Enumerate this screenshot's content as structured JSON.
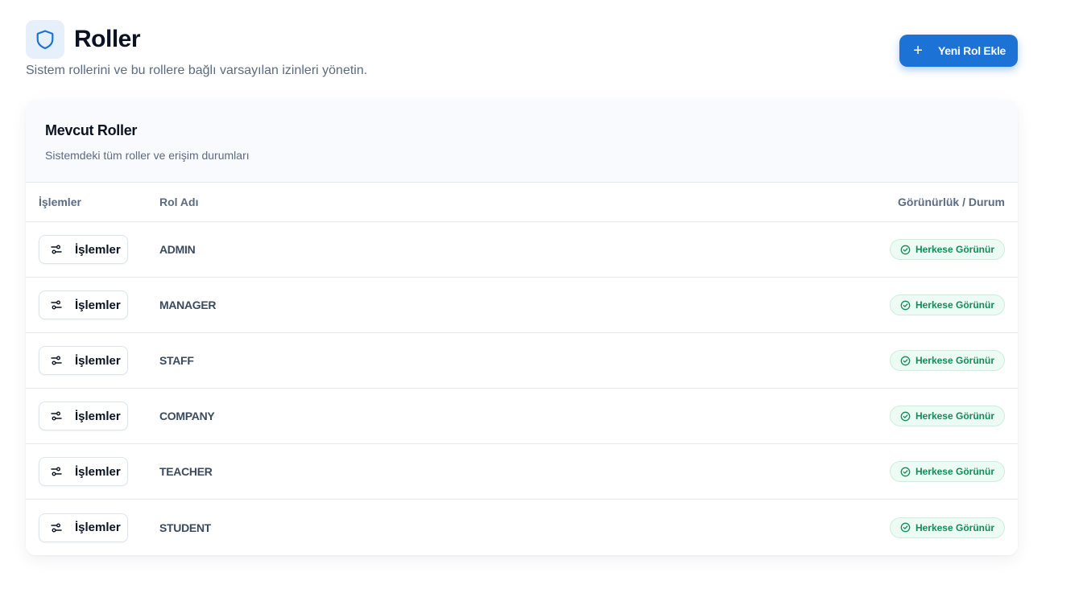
{
  "header": {
    "title": "Roller",
    "subtitle": "Sistem rollerini ve bu rollere bağlı varsayılan izinleri yönetin.",
    "add_button_label": "Yeni Rol Ekle",
    "title_icon": "shield-icon"
  },
  "card": {
    "title": "Mevcut Roller",
    "description": "Sistemdeki tüm roller ve erişim durumları"
  },
  "table": {
    "columns": {
      "actions": "İşlemler",
      "name": "Rol Adı",
      "visibility": "Görünürlük / Durum"
    },
    "rows": [
      {
        "action_label": "İşlemler",
        "name": "ADMIN",
        "status": "Herkese Görünür"
      },
      {
        "action_label": "İşlemler",
        "name": "MANAGER",
        "status": "Herkese Görünür"
      },
      {
        "action_label": "İşlemler",
        "name": "STAFF",
        "status": "Herkese Görünür"
      },
      {
        "action_label": "İşlemler",
        "name": "COMPANY",
        "status": "Herkese Görünür"
      },
      {
        "action_label": "İşlemler",
        "name": "TEACHER",
        "status": "Herkese Görünür"
      },
      {
        "action_label": "İşlemler",
        "name": "STUDENT",
        "status": "Herkese Görünür"
      }
    ]
  },
  "colors": {
    "accent": "#1d72d6",
    "status_green": "#148a5a",
    "status_bg": "#ecfbf3"
  }
}
